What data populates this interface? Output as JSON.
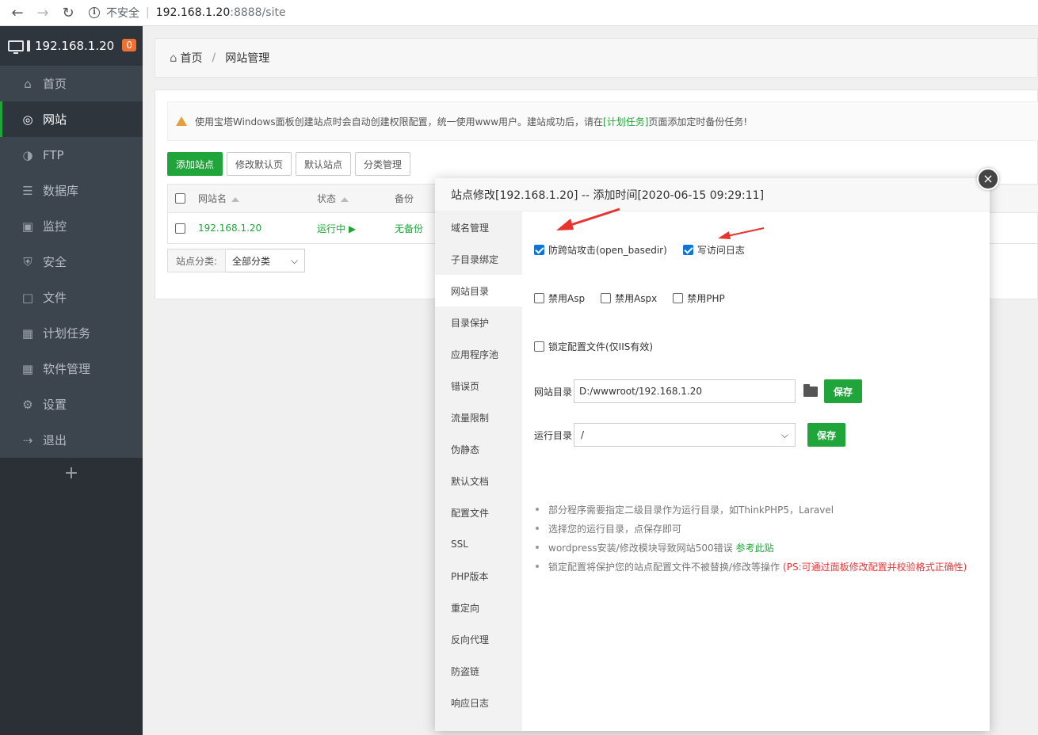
{
  "browser": {
    "insecure_label": "不安全",
    "url_host": "192.168.1.20",
    "url_path": ":8888/site"
  },
  "sidebar": {
    "host": "192.168.1.20",
    "badge": "0",
    "items": [
      {
        "label": "首页",
        "icon": "home-icon"
      },
      {
        "label": "网站",
        "icon": "globe-icon"
      },
      {
        "label": "FTP",
        "icon": "ftp-icon"
      },
      {
        "label": "数据库",
        "icon": "database-icon"
      },
      {
        "label": "监控",
        "icon": "monitor-icon"
      },
      {
        "label": "安全",
        "icon": "shield-icon"
      },
      {
        "label": "文件",
        "icon": "folder-icon"
      },
      {
        "label": "计划任务",
        "icon": "calendar-icon"
      },
      {
        "label": "软件管理",
        "icon": "apps-icon"
      },
      {
        "label": "设置",
        "icon": "gear-icon"
      },
      {
        "label": "退出",
        "icon": "logout-icon"
      }
    ],
    "add": "+"
  },
  "breadcrumb": {
    "home": "首页",
    "sep": "/",
    "current": "网站管理"
  },
  "notice": {
    "text_before": "使用宝塔Windows面板创建站点时会自动创建权限配置，统一使用www用户。建站成功后，请在",
    "link": "[计划任务]",
    "text_after": "页面添加定时备份任务!"
  },
  "toolbar": {
    "add_site": "添加站点",
    "edit_default_page": "修改默认页",
    "default_site": "默认站点",
    "category_manage": "分类管理"
  },
  "table": {
    "headers": {
      "name": "网站名",
      "status": "状态",
      "backup": "备份"
    },
    "rows": [
      {
        "name": "192.168.1.20",
        "status": "运行中 ▶",
        "backup": "无备份"
      }
    ]
  },
  "category": {
    "label": "站点分类:",
    "selected": "全部分类"
  },
  "modal": {
    "title": "站点修改[192.168.1.20] -- 添加时间[2020-06-15 09:29:11]",
    "close": "×",
    "tabs": [
      "域名管理",
      "子目录绑定",
      "网站目录",
      "目录保护",
      "应用程序池",
      "错误页",
      "流量限制",
      "伪静态",
      "默认文档",
      "配置文件",
      "SSL",
      "PHP版本",
      "重定向",
      "反向代理",
      "防盗链",
      "响应日志"
    ],
    "active_tab": 2,
    "options_row1": [
      {
        "label": "防跨站攻击(open_basedir)",
        "checked": true
      },
      {
        "label": "写访问日志",
        "checked": true
      }
    ],
    "options_row2": [
      {
        "label": "禁用Asp",
        "checked": false
      },
      {
        "label": "禁用Aspx",
        "checked": false
      },
      {
        "label": "禁用PHP",
        "checked": false
      }
    ],
    "options_row3": [
      {
        "label": "锁定配置文件(仅IIS有效)",
        "checked": false
      }
    ],
    "site_dir_label": "网站目录",
    "site_dir_value": "D:/wwwroot/192.168.1.20",
    "save_label": "保存",
    "run_dir_label": "运行目录",
    "run_dir_value": "/",
    "tips": [
      {
        "text": "部分程序需要指定二级目录作为运行目录，如ThinkPHP5，Laravel"
      },
      {
        "text": "选择您的运行目录，点保存即可"
      },
      {
        "text": "wordpress安装/修改模块导致网站500错误",
        "link": "参考此贴"
      },
      {
        "text": "锁定配置将保护您的站点配置文件不被替换/修改等操作",
        "red": "(PS:可通过面板修改配置并校验格式正确性)"
      }
    ]
  },
  "colors": {
    "accent_green": "#20a53a",
    "sidebar_bg": "#3c444d",
    "arrow_red": "#e8332e"
  }
}
